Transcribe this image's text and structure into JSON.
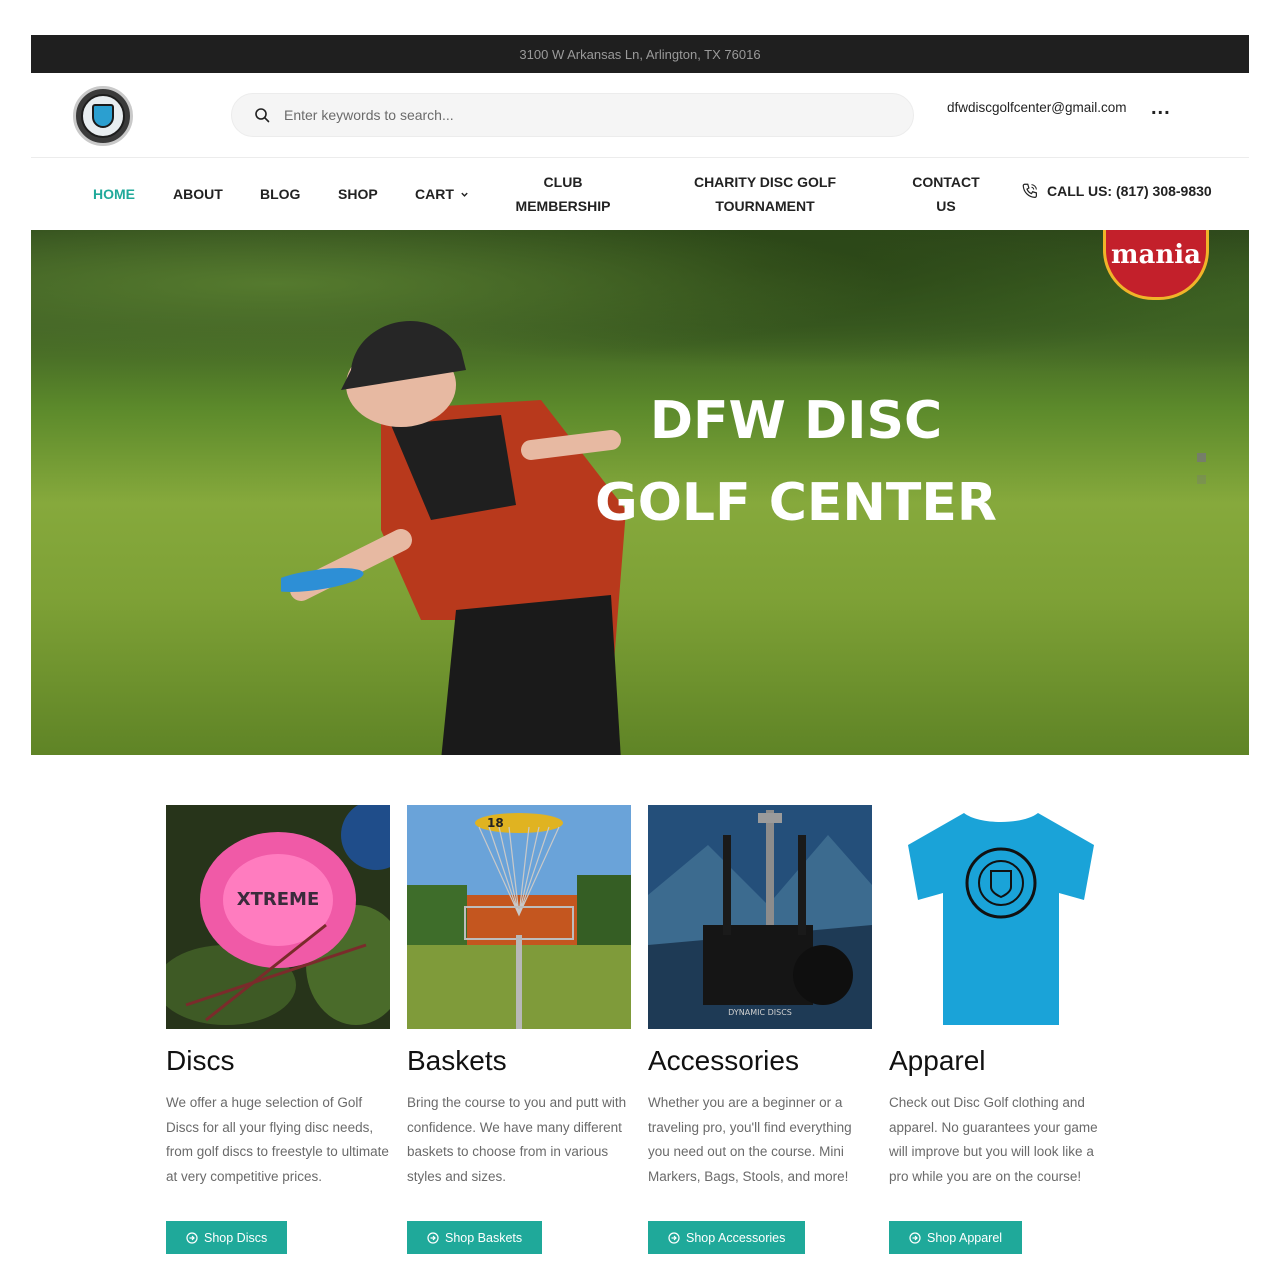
{
  "topbar": {
    "address": "3100 W Arkansas Ln, Arlington, TX 76016"
  },
  "header": {
    "search_placeholder": "Enter keywords to search...",
    "email": "dfwdiscgolfcenter@gmail.com",
    "more_label": "..."
  },
  "nav": {
    "items": [
      {
        "label": "HOME",
        "active": true
      },
      {
        "label": "ABOUT"
      },
      {
        "label": "BLOG"
      },
      {
        "label": "SHOP"
      },
      {
        "label": "CART"
      },
      {
        "label": "CLUB MEMBERSHIP"
      },
      {
        "label": "CHARITY DISC GOLF TOURNAMENT"
      },
      {
        "label": "CONTACT US"
      }
    ],
    "call": "CALL US: (817) 308-9830"
  },
  "hero": {
    "title_line1": "DFW DISC",
    "title_line2": "GOLF CENTER",
    "badge_text": "mania",
    "slide_count": 2,
    "active_slide": 1
  },
  "categories": [
    {
      "title": "Discs",
      "description": "We offer a huge selection of Golf Discs for all your flying disc needs, from golf discs to freestyle to ultimate at very competitive prices.",
      "button": "Shop Discs",
      "image": "pink-disc-photo"
    },
    {
      "title": "Baskets",
      "description": "Bring the course to you and putt with confidence. We have many different baskets to choose from in various styles and sizes.",
      "button": "Shop Baskets",
      "image": "disc-golf-basket-photo",
      "basket_number": "18"
    },
    {
      "title": "Accessories",
      "description": "Whether you are a beginner or a traveling pro, you'll find everything you need out on the course. Mini Markers, Bags, Stools, and more!",
      "button": "Shop Accessories",
      "image": "disc-cart-photo",
      "cart_brand": "DYNAMIC DISCS"
    },
    {
      "title": "Apparel",
      "description": "Check out Disc Golf clothing and apparel. No guarantees your game will improve but you will look like a pro while you are on the course!",
      "button": "Shop Apparel",
      "image": "blue-tshirt-photo"
    }
  ],
  "colors": {
    "accent": "#1fa99a",
    "topbar": "#1f1f1f"
  }
}
